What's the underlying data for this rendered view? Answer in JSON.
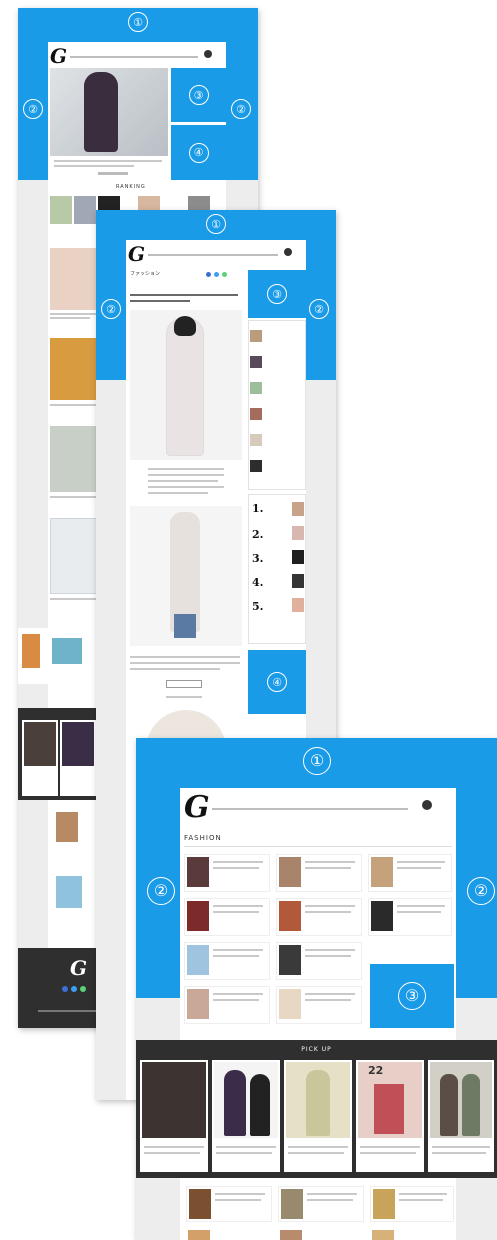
{
  "labels": {
    "header": "①",
    "side": "②",
    "slot3": "③",
    "slot4": "④"
  },
  "logo": "G",
  "layout1": {
    "section_heading": "RANKING"
  },
  "layout2": {
    "category": "ファッション",
    "ranking_numbers": [
      "1.",
      "2.",
      "3.",
      "4.",
      "5."
    ]
  },
  "layout3": {
    "section_heading": "FASHION",
    "pickup_heading": "PICK UP",
    "magazine_number": "22"
  },
  "colors": {
    "accent": "#1a9be8",
    "page_gray": "#ededed",
    "footer_dark": "#2f2f2f"
  }
}
